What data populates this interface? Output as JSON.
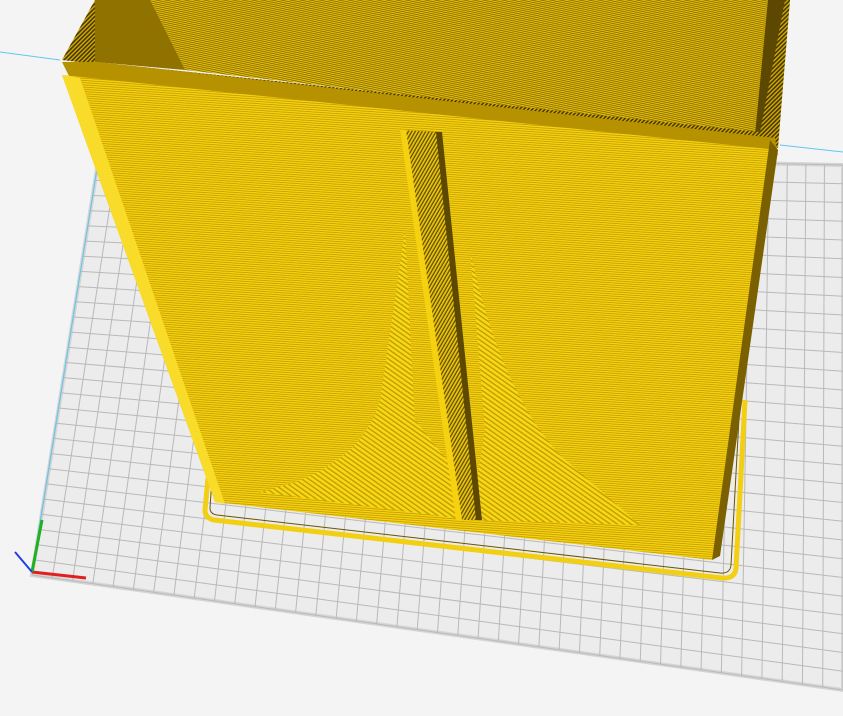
{
  "viewport": {
    "view": "layer-preview",
    "colors": {
      "background": "#f4f4f4",
      "build_plate": "#ececec",
      "grid_line": "#b9b9b9",
      "build_plate_border": "#d5d5d5",
      "model_light": "#f6d10f",
      "model_mid": "#e4bd0a",
      "model_dark": "#5c4800",
      "skirt": "#f2cf12",
      "axis_x": "#e02020",
      "axis_y": "#20b020",
      "axis_z": "#2040e0",
      "boundary_line": "#5ec8f0"
    },
    "icons": {
      "axis_x": "axis-x-icon",
      "axis_y": "axis-y-icon",
      "axis_z": "axis-z-icon"
    }
  }
}
